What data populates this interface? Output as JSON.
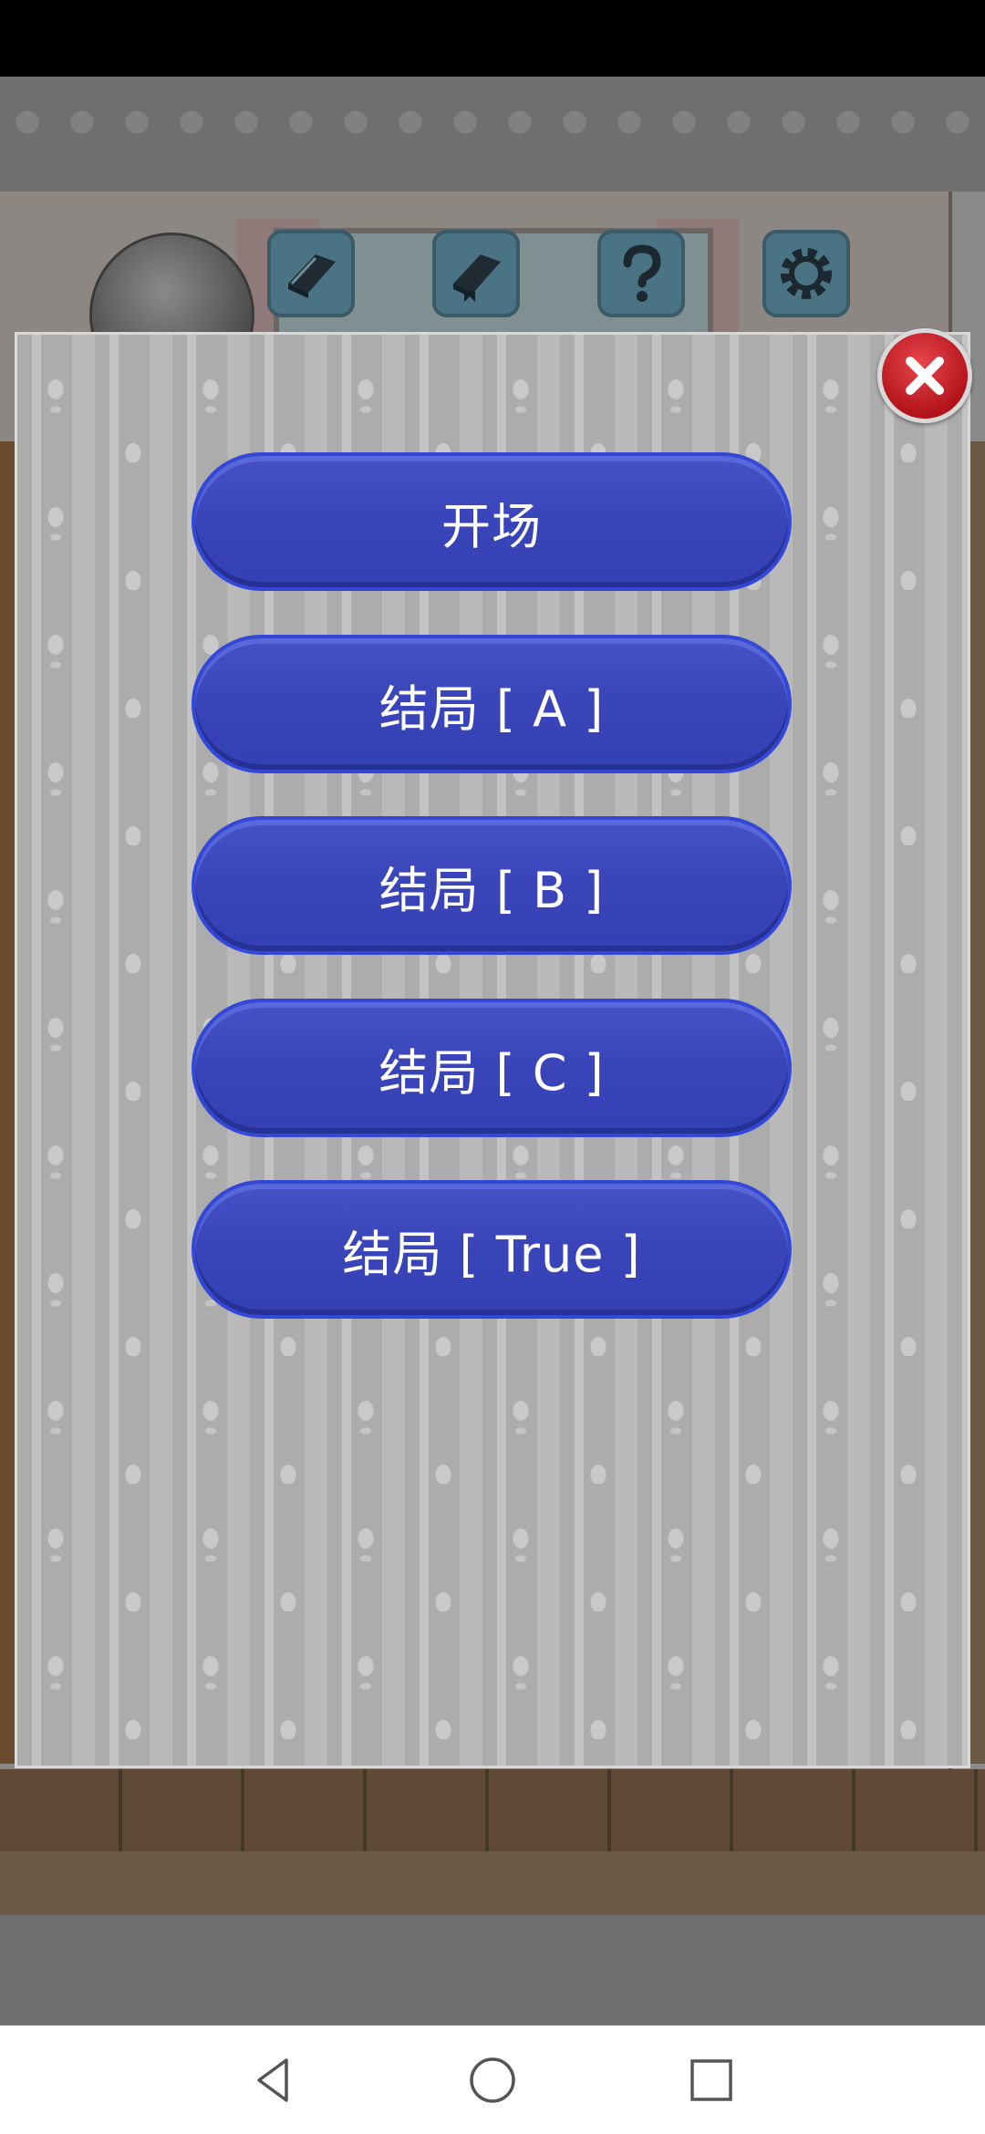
{
  "hud": {
    "icons": [
      "book-icon",
      "bookmark-book-icon",
      "help-icon",
      "gear-icon"
    ]
  },
  "modal": {
    "close_icon": "close-icon",
    "chapters": [
      {
        "label": "开场"
      },
      {
        "label": "结局 [ A ]"
      },
      {
        "label": "结局 [ B ]"
      },
      {
        "label": "结局 [ C ]"
      },
      {
        "label": "结局 [ True ]"
      }
    ]
  },
  "nav": {
    "icons": [
      "back-icon",
      "home-icon",
      "recents-icon"
    ]
  },
  "colors": {
    "button_blue": "#3a45b9",
    "close_red": "#c4202a",
    "panel_gray": "#b3b3b3"
  }
}
